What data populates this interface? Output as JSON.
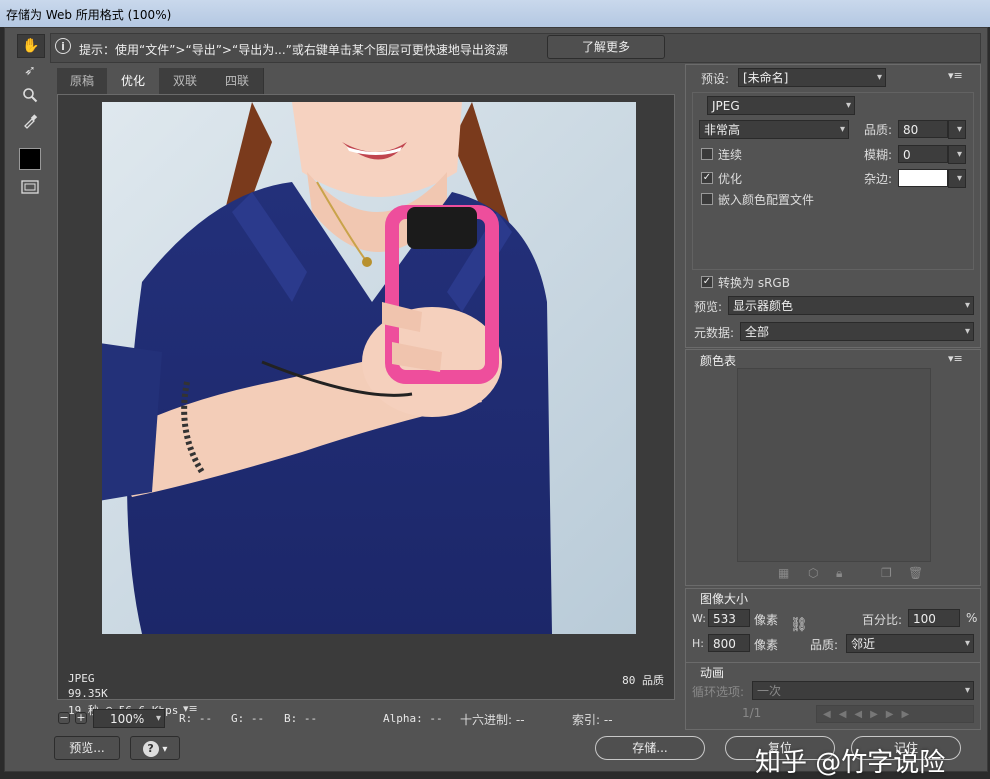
{
  "window": {
    "title": "存储为 Web 所用格式 (100%)"
  },
  "hint": {
    "text": "提示：使用“文件”>“导出”>“导出为...”或右键单击某个图层可更快速地导出资源",
    "learn_more": "了解更多"
  },
  "tabs": [
    "原稿",
    "优化",
    "双联",
    "四联"
  ],
  "image_info": {
    "format": "JPEG",
    "size": "99.35K",
    "time": "19 秒 @ 56.6 Kbps",
    "quality": "80 品质"
  },
  "status_bar": {
    "zoom": "100%",
    "r": "R: --",
    "g": "G: --",
    "b": "B: --",
    "alpha": "Alpha: --",
    "hex": "十六进制: --",
    "index": "索引: --"
  },
  "bottom_buttons": {
    "preview": "预览...",
    "save": "存储...",
    "reset": "复位",
    "remember": "记住"
  },
  "settings": {
    "preset_label": "预设:",
    "preset_value": "[未命名]",
    "format": "JPEG",
    "quality_preset": "非常高",
    "quality_label": "品质:",
    "quality_value": "80",
    "progressive_label": "连续",
    "blur_label": "模糊:",
    "blur_value": "0",
    "optimized_label": "优化",
    "matte_label": "杂边:",
    "embed_profile_label": "嵌入颜色配置文件",
    "convert_srgb_label": "转换为 sRGB",
    "preview_label": "预览:",
    "preview_value": "显示器颜色",
    "metadata_label": "元数据:",
    "metadata_value": "全部"
  },
  "color_table": {
    "title": "颜色表"
  },
  "image_size": {
    "title": "图像大小",
    "w_label": "W:",
    "w_value": "533",
    "h_label": "H:",
    "h_value": "800",
    "unit": "像素",
    "percent_label": "百分比:",
    "percent_value": "100",
    "percent_unit": "%",
    "quality_label": "品质:",
    "quality_value": "邻近"
  },
  "animation": {
    "title": "动画",
    "loop_label": "循环选项:",
    "loop_value": "一次",
    "frame": "1/1"
  },
  "watermark": "知乎 @竹字说险"
}
